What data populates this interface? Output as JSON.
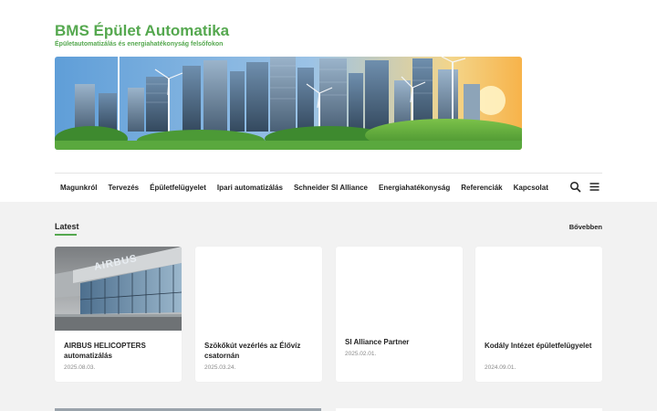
{
  "site": {
    "title": "BMS Épület Automatika",
    "tagline": "Épületautomatizálás és energiahatékonyság felsőfokon"
  },
  "nav": {
    "items": [
      "Magunkról",
      "Tervezés",
      "Épületfelügyelet",
      "Ipari automatizálás",
      "Schneider SI Alliance",
      "Energiahatékonyság",
      "Referenciák",
      "Kapcsolat"
    ],
    "icons": [
      "search-icon",
      "menu-icon"
    ]
  },
  "latest": {
    "heading": "Latest",
    "more_label": "Bővebben",
    "accent": "#55a84f",
    "cards": [
      {
        "title": "AIRBUS HELICOPTERS automatizálás",
        "date": "2025.08.03.",
        "image_text": "AIRBUS"
      },
      {
        "title": "Szökőkút vezérlés az Élővíz csatornán",
        "date": "2025.03.24."
      },
      {
        "title": "SI Alliance Partner",
        "date": "2025.02.01."
      },
      {
        "title": "Kodály Intézet épületfelügyelet",
        "date": "2024.09.01."
      }
    ]
  }
}
